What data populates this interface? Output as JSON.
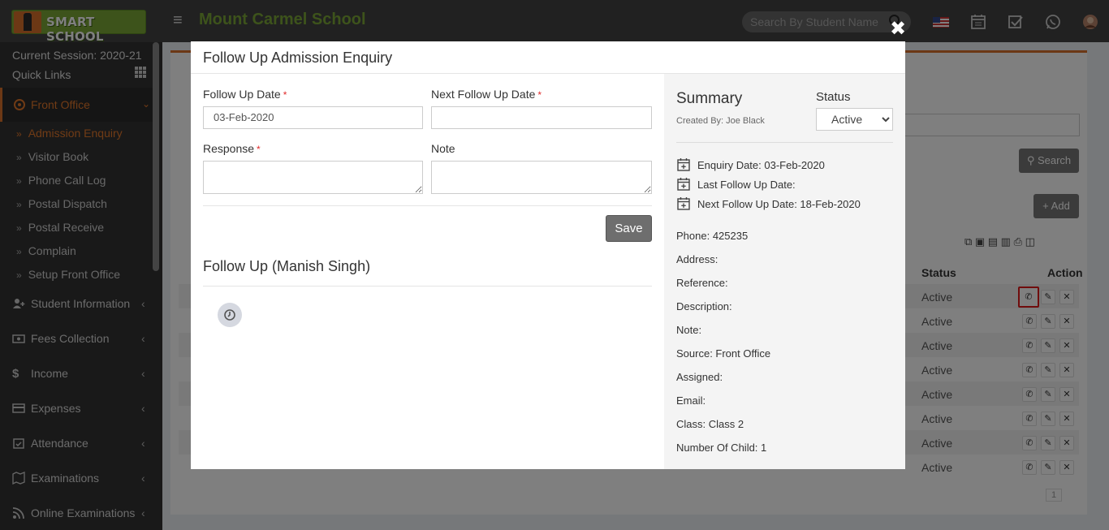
{
  "header": {
    "logo_text": "SMART SCHOOL",
    "school_name": "Mount Carmel School",
    "search_placeholder": "Search By Student Name"
  },
  "sidebar": {
    "session": "Current Session: 2020-21",
    "quick_links": "Quick Links",
    "front_office": "Front Office",
    "sub_items": [
      "Admission Enquiry",
      "Visitor Book",
      "Phone Call Log",
      "Postal Dispatch",
      "Postal Receive",
      "Complain",
      "Setup Front Office"
    ],
    "main_items": [
      "Student Information",
      "Fees Collection",
      "Income",
      "Expenses",
      "Attendance",
      "Examinations",
      "Online Examinations"
    ]
  },
  "background": {
    "search_button": "Search",
    "add_button": "Add",
    "status_header": "Status",
    "action_header": "Action",
    "rows": [
      {
        "status": "Active"
      },
      {
        "status": "Active"
      },
      {
        "status": "Active"
      },
      {
        "status": "Active"
      },
      {
        "status": "Active"
      },
      {
        "status": "Active"
      },
      {
        "status": "Active"
      },
      {
        "status": "Active"
      }
    ],
    "page": "1"
  },
  "modal": {
    "title": "Follow Up Admission Enquiry",
    "followup_date_label": "Follow Up Date",
    "followup_date_value": "03-Feb-2020",
    "next_followup_label": "Next Follow Up Date",
    "response_label": "Response",
    "note_label": "Note",
    "save_label": "Save",
    "followup_heading": "Follow Up (Manish Singh)",
    "summary": {
      "title": "Summary",
      "created_by": "Created By: Joe Black",
      "status_label": "Status",
      "status_value": "Active",
      "enquiry_date": "Enquiry Date: 03-Feb-2020",
      "last_followup": "Last Follow Up Date:",
      "next_followup": "Next Follow Up Date: 18-Feb-2020",
      "phone": "Phone: 425235",
      "address": "Address:",
      "reference": "Reference:",
      "description": "Description:",
      "note": "Note:",
      "source": "Source: Front Office",
      "assigned": "Assigned:",
      "email": "Email:",
      "class": "Class: Class 2",
      "children": "Number Of Child: 1"
    }
  }
}
